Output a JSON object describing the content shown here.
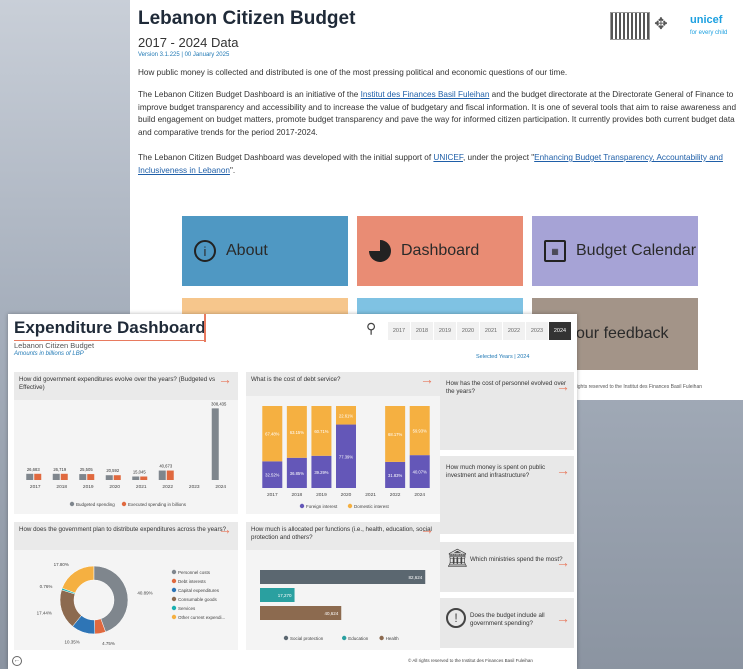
{
  "back": {
    "title": "Lebanon Citizen Budget",
    "subtitle": "2017 - 2024 Data",
    "version": "Version 3.1.225 | 00 January 2025",
    "unicef": "unicef",
    "unicef_tag": "for every child",
    "p1": "How public money is collected and distributed is one of the most pressing political and economic questions of our time.",
    "p2a": "The Lebanon Citizen Budget Dashboard is an initiative of the ",
    "p2link": "Institut des Finances Basil Fuleihan",
    "p2b": " and the budget directorate at the Directorate General of Finance to improve budget transparency and accessibility and to increase the value of budgetary and fiscal information. It is one of several tools that aim to raise awareness and build engagement on budget matters, promote budget transparency and pave the way for informed citizen participation. It currently provides both current budget data and comparative trends for the period 2017-2024.",
    "p3a": "The Lebanon Citizen Budget Dashboard was developed with the initial support of ",
    "p3link1": "UNICEF",
    "p3b": ", under the project \"",
    "p3link2": "Enhancing Budget Transparency, Accountability and Inclusiveness in Lebanon",
    "p3c": "\".",
    "tiles": [
      {
        "label": "About",
        "icon": "info-icon",
        "color": "#4f98c3"
      },
      {
        "label": "Dashboard",
        "icon": "pie-icon",
        "color": "#e98c74"
      },
      {
        "label": "Budget Calendar",
        "icon": "calendar-icon",
        "color": "#a6a3d6"
      },
      {
        "label": "our feedback",
        "color": "#a39488"
      }
    ],
    "footer": "rights reserved to the Institut des Finances Basil Fuleihan"
  },
  "front": {
    "title": "Expenditure Dashboard",
    "sub1": "Lebanon Citizen Budget",
    "sub2": "Amounts in billions of LBP",
    "years": [
      "2017",
      "2018",
      "2019",
      "2020",
      "2021",
      "2022",
      "2023",
      "2024"
    ],
    "selected_year": "2024",
    "selected_label": "Selected Years | 2024",
    "q1": "How did government expenditures evolve over the years? (Budgeted vs Effective)",
    "q2": "What is the cost of debt service?",
    "q3": "How has the cost of personnel evolved over the years?",
    "q4": "How much money is spent on public investment and infrastructure?",
    "q5": "How does the government plan to distribute expenditures across the years?",
    "q6": "How much is allocated per functions (i.e., health, education, social protection and others?",
    "q7": "Which ministries spend the most?",
    "q8": "Does the budget include all government spending?",
    "copyright": "© All rights reserved to the Institut des Finances Basil Fuleihan"
  },
  "colors": {
    "budgeted": "#7f868d",
    "executed": "#e0693f",
    "foreign": "#6457b8",
    "domestic": "#f5b041"
  },
  "chart_data": [
    {
      "type": "bar",
      "categories": [
        "2017",
        "2018",
        "2019",
        "2020",
        "2021",
        "2022",
        "2023",
        "2024"
      ],
      "series": [
        {
          "name": "Budgeted spending",
          "values": [
            26683,
            26719,
            25505,
            20592,
            15045,
            40673,
            null,
            308435
          ]
        },
        {
          "name": "Executed spending in billions",
          "values": [
            26683,
            26719,
            25505,
            20592,
            15045,
            40673,
            null,
            null
          ]
        }
      ],
      "data_labels": [
        "26,683",
        "26,719",
        "25,505",
        "20,592",
        "15,045",
        "40,673",
        "",
        "308,435"
      ]
    },
    {
      "type": "bar",
      "stacked": true,
      "categories": [
        "2017",
        "2018",
        "2019",
        "2020",
        "2021",
        "2022",
        "2024"
      ],
      "series": [
        {
          "name": "Foreign interest",
          "values": [
            32.52,
            36.85,
            39.29,
            77.39,
            null,
            31.83,
            40.07
          ]
        },
        {
          "name": "Domestic interest",
          "values": [
            67.48,
            63.15,
            60.71,
            22.61,
            null,
            68.17,
            59.93
          ]
        }
      ],
      "foreign_labels": [
        "32.52%",
        "36.85%",
        "39.29%",
        "77.39%",
        "",
        "31.83%",
        "40.07%"
      ],
      "domestic_labels": [
        "67.48%",
        "63.15%",
        "60.71%",
        "22.61%",
        "",
        "68.17%",
        "59.93%"
      ]
    },
    {
      "type": "pie",
      "donut": true,
      "labels": [
        "Personnel costs",
        "Debt interests",
        "Capital expenditures",
        "Consumable goods",
        "Services",
        "Other current expendi..."
      ],
      "values": [
        40.89,
        4.75,
        10.35,
        17.44,
        0.76,
        17.8
      ],
      "value_labels": [
        "40.89%",
        "4.75%",
        "10.35%",
        "17.44%",
        "0.76%",
        "17.80%"
      ],
      "colors": [
        "#7f868d",
        "#e0693f",
        "#2e75b6",
        "#8c6a4f",
        "#1ab0b0",
        "#f5b041"
      ]
    },
    {
      "type": "bar",
      "orientation": "horizontal",
      "categories": [
        "Social protection",
        "Education",
        "Health"
      ],
      "values": [
        82624,
        17270,
        40624
      ],
      "value_labels": [
        "82,624",
        "17,270",
        "40,624"
      ],
      "colors": [
        "#5b6770",
        "#2aa0a0",
        "#8c6a4f"
      ]
    }
  ]
}
